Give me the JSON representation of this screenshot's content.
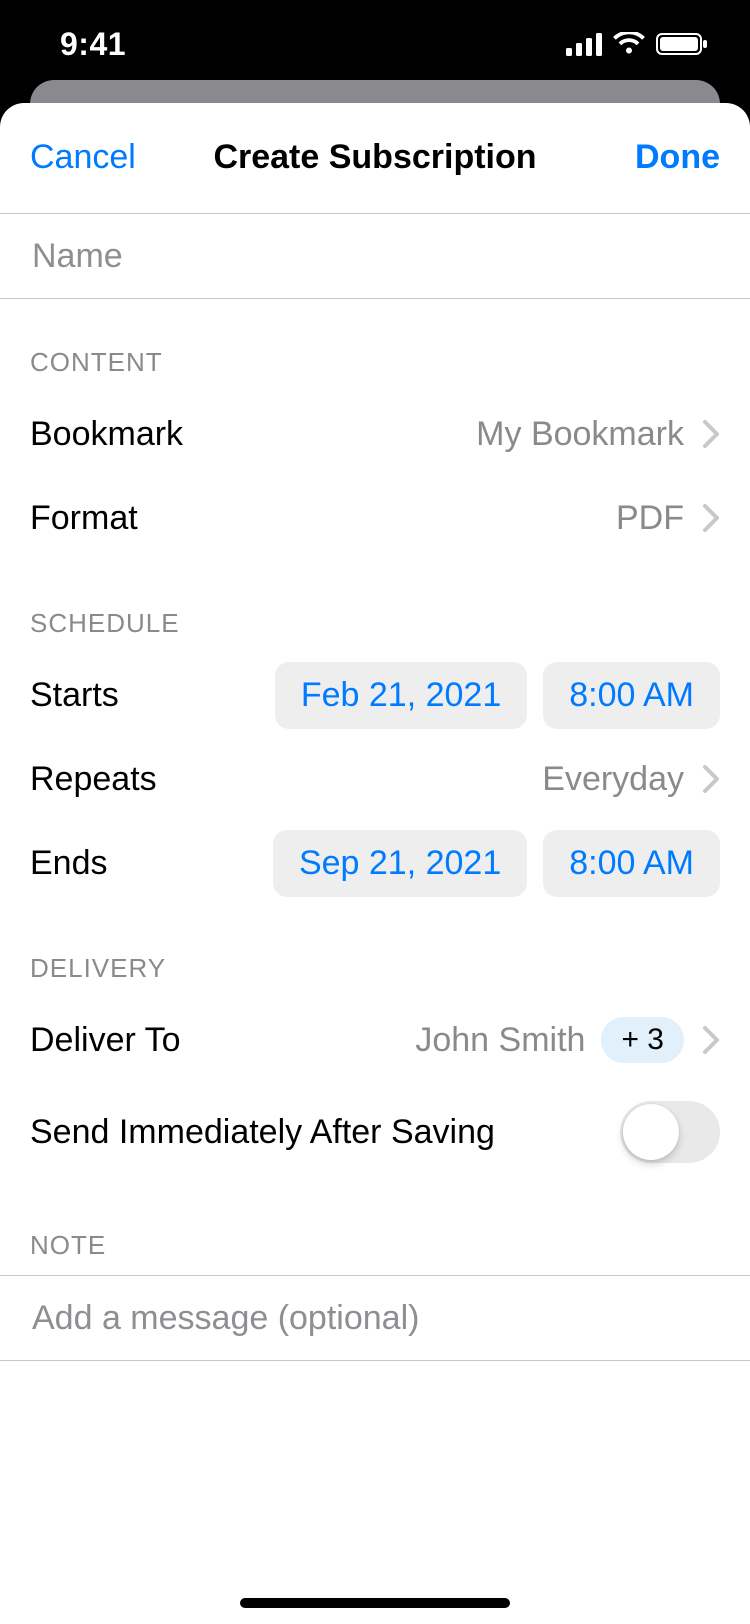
{
  "status": {
    "time": "9:41"
  },
  "nav": {
    "cancel": "Cancel",
    "title": "Create Subscription",
    "done": "Done"
  },
  "name": {
    "placeholder": "Name"
  },
  "sections": {
    "content": "CONTENT",
    "schedule": "SCHEDULE",
    "delivery": "DELIVERY",
    "note": "NOTE"
  },
  "content": {
    "bookmark_label": "Bookmark",
    "bookmark_value": "My Bookmark",
    "format_label": "Format",
    "format_value": "PDF"
  },
  "schedule": {
    "starts_label": "Starts",
    "starts_date": "Feb 21, 2021",
    "starts_time": "8:00 AM",
    "repeats_label": "Repeats",
    "repeats_value": "Everyday",
    "ends_label": "Ends",
    "ends_date": "Sep 21, 2021",
    "ends_time": "8:00 AM"
  },
  "delivery": {
    "deliver_to_label": "Deliver To",
    "deliver_to_value": "John Smith",
    "deliver_to_badge": "+ 3",
    "send_immediately_label": "Send Immediately After Saving",
    "send_immediately_on": false
  },
  "note": {
    "placeholder": "Add a message (optional)"
  }
}
